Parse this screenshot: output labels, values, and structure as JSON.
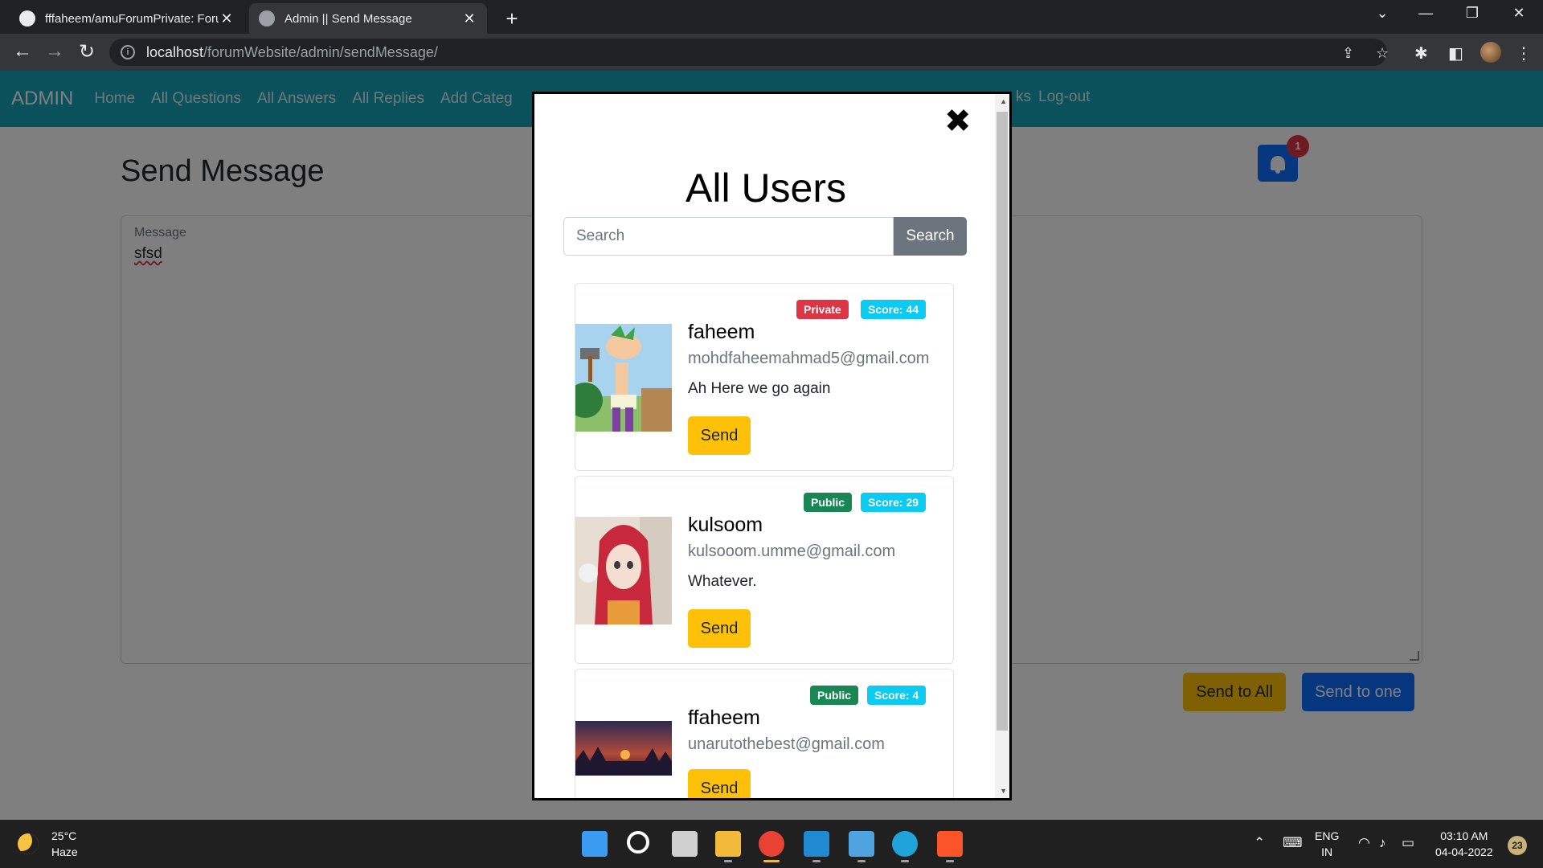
{
  "browser": {
    "tabs": [
      {
        "title": "fffaheem/amuForumPrivate: Foru"
      },
      {
        "title": "Admin || Send Message"
      }
    ],
    "url_host": "localhost",
    "url_path": "/forumWebsite/admin/sendMessage/"
  },
  "nav": {
    "brand": "ADMIN",
    "links": [
      "Home",
      "All Questions",
      "All Answers",
      "All Replies",
      "Add Categ"
    ],
    "partial_link": "ks",
    "logout": "Log-out"
  },
  "page": {
    "title": "Send Message",
    "notification_count": "1",
    "message_label": "Message",
    "message_value": "sfsd",
    "send_all_label": "Send to All",
    "send_one_label": "Send to one"
  },
  "modal": {
    "title": "All Users",
    "search_placeholder": "Search",
    "search_button": "Search",
    "users": [
      {
        "name": "faheem",
        "email": "mohdfaheemahmad5@gmail.com",
        "bio": "Ah Here we go again",
        "visibility": "Private",
        "score": "Score: 44",
        "send": "Send"
      },
      {
        "name": "kulsoom",
        "email": "kulsooom.umme@gmail.com",
        "bio": "Whatever.",
        "visibility": "Public",
        "score": "Score: 29",
        "send": "Send"
      },
      {
        "name": "ffaheem",
        "email": "unarutothebest@gmail.com",
        "bio": "",
        "visibility": "Public",
        "score": "Score: 4",
        "send": "Send"
      }
    ]
  },
  "taskbar": {
    "temp": "25°C",
    "weather": "Haze",
    "lang1": "ENG",
    "lang2": "IN",
    "time": "03:10 AM",
    "date": "04-04-2022",
    "notifications": "23"
  },
  "colors": {
    "nav": "#17a2b8",
    "warning": "#ffc107",
    "primary": "#0d6efd",
    "danger": "#dc3545",
    "success": "#198754",
    "info": "#0dcaf0"
  }
}
